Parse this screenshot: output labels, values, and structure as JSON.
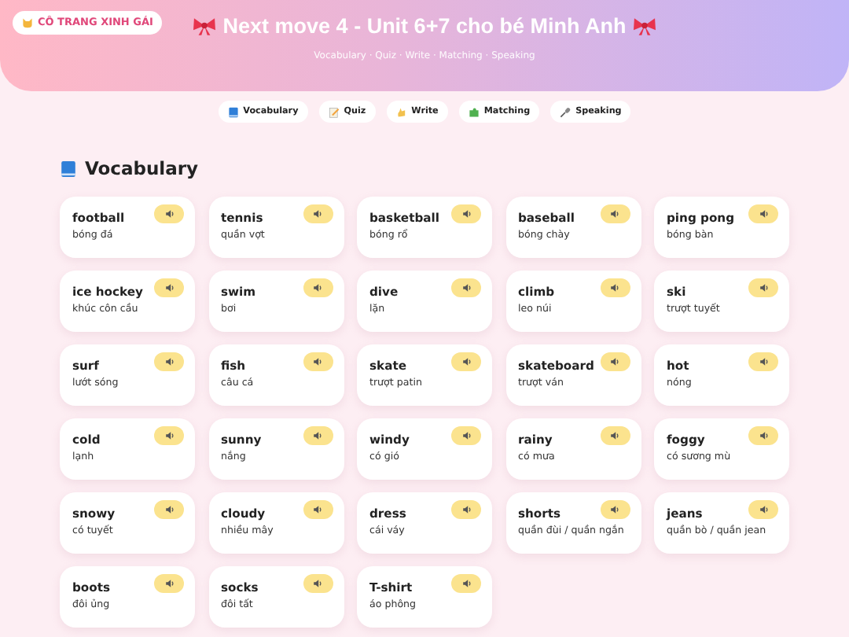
{
  "header": {
    "badge": "CÔ TRANG XINH GÁI",
    "title": "Next move 4 - Unit 6+7 cho bé Minh Anh",
    "subtitle": "Vocabulary · Quiz · Write · Matching · Speaking"
  },
  "nav": [
    {
      "label": "Vocabulary"
    },
    {
      "label": "Quiz"
    },
    {
      "label": "Write"
    },
    {
      "label": "Matching"
    },
    {
      "label": "Speaking"
    }
  ],
  "section": {
    "title": "Vocabulary"
  },
  "words": [
    {
      "word": "football",
      "meaning": "bóng đá"
    },
    {
      "word": "tennis",
      "meaning": "quần vợt"
    },
    {
      "word": "basketball",
      "meaning": "bóng rổ"
    },
    {
      "word": "baseball",
      "meaning": "bóng chày"
    },
    {
      "word": "ping pong",
      "meaning": "bóng bàn"
    },
    {
      "word": "ice hockey",
      "meaning": "khúc côn cầu"
    },
    {
      "word": "swim",
      "meaning": "bơi"
    },
    {
      "word": "dive",
      "meaning": "lặn"
    },
    {
      "word": "climb",
      "meaning": "leo núi"
    },
    {
      "word": "ski",
      "meaning": "trượt tuyết"
    },
    {
      "word": "surf",
      "meaning": "lướt sóng"
    },
    {
      "word": "fish",
      "meaning": "câu cá"
    },
    {
      "word": "skate",
      "meaning": "trượt patin"
    },
    {
      "word": "skateboard",
      "meaning": "trượt ván"
    },
    {
      "word": "hot",
      "meaning": "nóng"
    },
    {
      "word": "cold",
      "meaning": "lạnh"
    },
    {
      "word": "sunny",
      "meaning": "nắng"
    },
    {
      "word": "windy",
      "meaning": "có gió"
    },
    {
      "word": "rainy",
      "meaning": "có mưa"
    },
    {
      "word": "foggy",
      "meaning": "có sương mù"
    },
    {
      "word": "snowy",
      "meaning": "có tuyết"
    },
    {
      "word": "cloudy",
      "meaning": "nhiều mây"
    },
    {
      "word": "dress",
      "meaning": "cái váy"
    },
    {
      "word": "shorts",
      "meaning": "quần đùi / quần ngắn"
    },
    {
      "word": "jeans",
      "meaning": "quần bò / quần jean"
    },
    {
      "word": "boots",
      "meaning": "đôi ủng"
    },
    {
      "word": "socks",
      "meaning": "đôi tất"
    },
    {
      "word": "T-shirt",
      "meaning": "áo phông"
    }
  ]
}
